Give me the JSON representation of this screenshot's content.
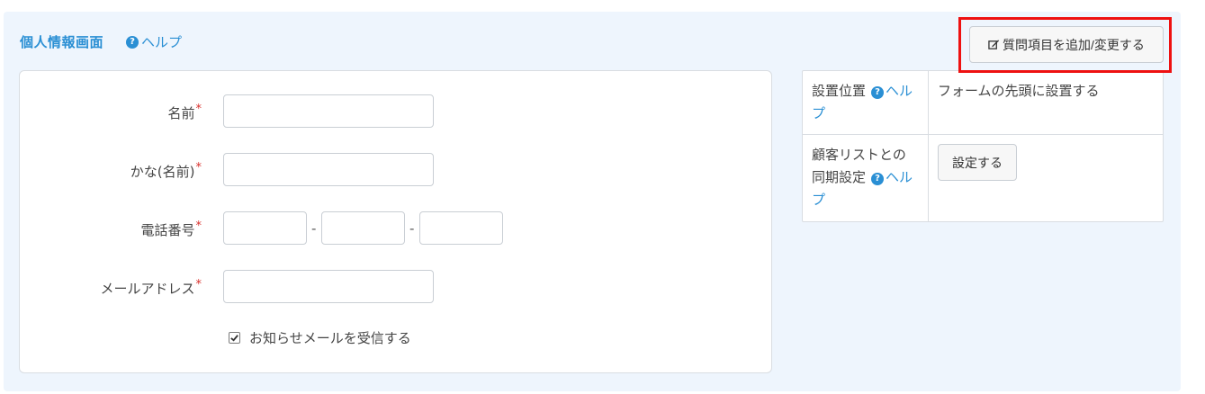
{
  "panel": {
    "title": "個人情報画面",
    "help_label": "ヘルプ",
    "help_icon": "question-circle-icon"
  },
  "form": {
    "fields": [
      {
        "label": "名前",
        "required": "*"
      },
      {
        "label": "かな(名前)",
        "required": "*"
      },
      {
        "label": "電話番号",
        "required": "*",
        "separator": "-"
      },
      {
        "label": "メールアドレス",
        "required": "*"
      }
    ],
    "newsletter_label": "お知らせメールを受信する",
    "newsletter_checked": true
  },
  "settings": {
    "position_label": "設置位置",
    "position_help": "ヘルプ",
    "position_value": "フォームの先頭に設置する",
    "sync_label": "顧客リストとの同期設定",
    "sync_help": "ヘルプ",
    "sync_button": "設定する"
  },
  "toolbar": {
    "add_button_label": "質問項目を追加/変更する",
    "add_button_icon": "edit-icon"
  },
  "colors": {
    "accent": "#2a8fd4",
    "panel_bg": "#eef5fd",
    "required": "#d9302c",
    "highlight": "#ee1111"
  }
}
